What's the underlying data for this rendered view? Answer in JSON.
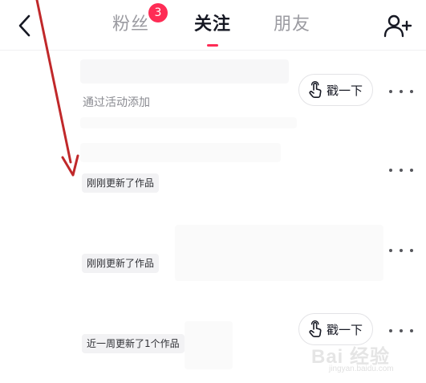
{
  "header": {
    "tabs": {
      "fans": {
        "label": "粉丝",
        "badge": "3"
      },
      "following": {
        "label": "关注"
      },
      "friends": {
        "label": "朋友"
      }
    },
    "icons": {
      "back": "chevron-left-icon",
      "add_friend": "add-friend-icon"
    }
  },
  "list": {
    "items": [
      {
        "subtitle": "通过活动添加",
        "action_label": "戳一下"
      },
      {
        "tag": "刚刚更新了作品"
      },
      {
        "tag": "刚刚更新了作品"
      },
      {
        "tag": "近一周更新了1个作品",
        "action_label": "戳一下"
      }
    ]
  },
  "watermark": {
    "logo_text": "Bai 经验",
    "site": "jingyan.baidu.com"
  },
  "colors": {
    "accent": "#fe2c55",
    "annotation": "#c0282a",
    "text_primary": "#161823",
    "text_secondary": "#9b9ba1"
  }
}
